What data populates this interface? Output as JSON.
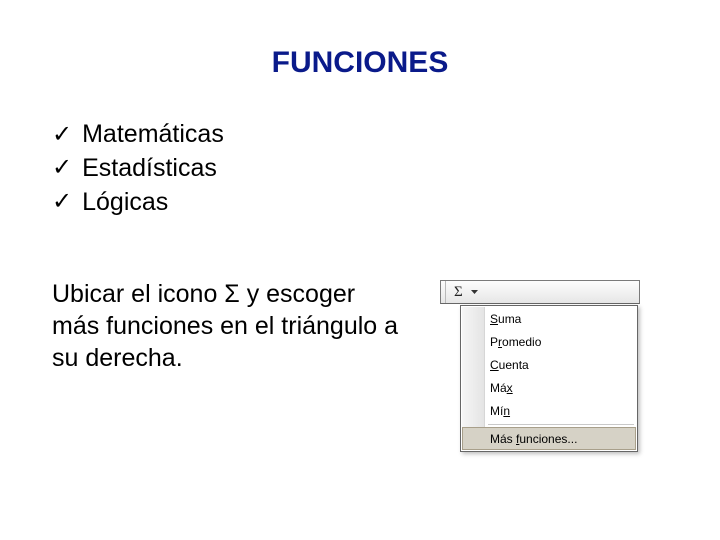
{
  "title": "FUNCIONES",
  "bullets": [
    {
      "label": "Matemáticas"
    },
    {
      "label": "Estadísticas"
    },
    {
      "label": "Lógicas"
    }
  ],
  "paragraph": "Ubicar el icono Σ  y escoger más funciones en el triángulo a su derecha.",
  "toolbar": {
    "sigma_glyph": "Σ"
  },
  "menu": {
    "items": [
      {
        "prefix": "",
        "underlined": "S",
        "rest": "uma"
      },
      {
        "prefix": "P",
        "underlined": "r",
        "rest": "omedio"
      },
      {
        "prefix": "",
        "underlined": "C",
        "rest": "uenta"
      },
      {
        "prefix": "Má",
        "underlined": "x",
        "rest": ""
      },
      {
        "prefix": "Mí",
        "underlined": "n",
        "rest": ""
      }
    ],
    "more": {
      "prefix": "Más ",
      "underlined": "f",
      "rest": "unciones..."
    }
  }
}
